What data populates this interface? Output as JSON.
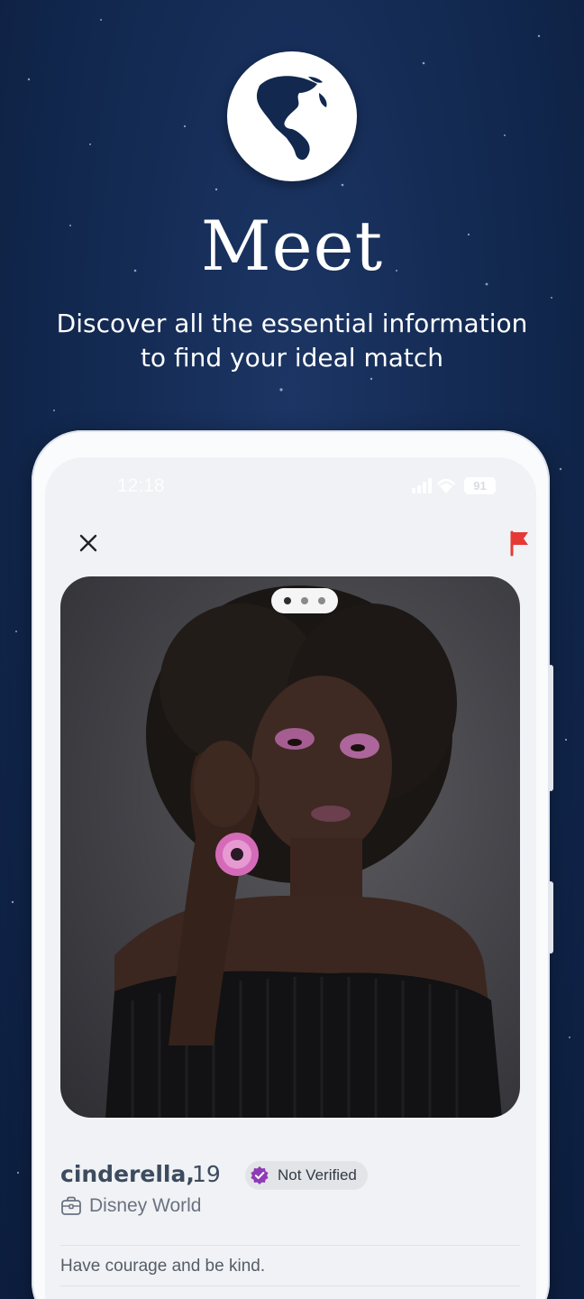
{
  "hero": {
    "title": "Meet",
    "subtitle_line1": "Discover all the essential information",
    "subtitle_line2": "to find your ideal match"
  },
  "phone": {
    "status_bar": {
      "time": "12:18",
      "battery": "91"
    },
    "toolbar": {
      "close_icon": "close-icon",
      "report_icon": "flag-icon"
    },
    "photo": {
      "pager_total": 3,
      "pager_active": 1
    },
    "profile": {
      "name": "cinderella,",
      "age": "19",
      "verification_label": "Not Verified",
      "location": "Disney World",
      "bio": "Have courage and be kind."
    },
    "colors": {
      "report_flag": "#e53935",
      "verify_seal": "#8e3bb5",
      "name_text": "#3d4b5f"
    }
  }
}
